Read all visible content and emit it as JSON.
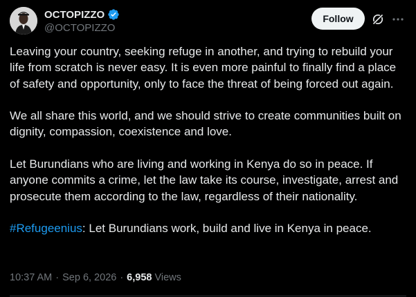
{
  "author": {
    "display_name": "OCTOPIZZO",
    "handle": "@OCTOPIZZO",
    "verified": true,
    "avatar_icon": "avatar-portrait"
  },
  "actions": {
    "follow_label": "Follow",
    "grok_icon": "grok-icon",
    "more_icon": "more-icon"
  },
  "post": {
    "paragraphs": [
      "Leaving your country, seeking refuge in another, and trying to rebuild your life from scratch is never easy. It is even more painful to finally find a place of safety and opportunity, only to face the threat of being forced out again.",
      "We all share this world, and we should strive to create communities built on dignity, compassion, coexistence and love.",
      "Let Burundians who are living and working in Kenya do so in peace. If anyone commits a crime, let the law take its course, investigate, arrest and prosecute them according to the law, regardless of their nationality."
    ],
    "hashtag": "#Refugeenius",
    "last_line_rest": ": Let Burundians work, build and live in Kenya in peace."
  },
  "meta": {
    "time": "10:37 AM",
    "date": "Sep 6, 2026",
    "separator": "·",
    "views_count": "6,958",
    "views_label": "Views"
  },
  "colors": {
    "background": "#000000",
    "text": "#e7e9ea",
    "muted": "#71767b",
    "link": "#1d9bf0",
    "verified_badge": "#1d9bf0",
    "follow_bg": "#eff3f4"
  }
}
